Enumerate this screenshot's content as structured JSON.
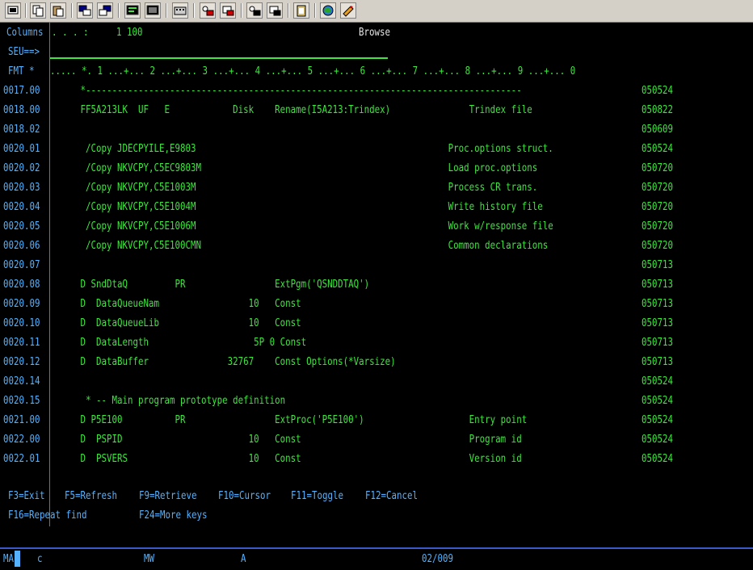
{
  "toolbar": {
    "buttons": [
      {
        "name": "print-screen-icon"
      },
      {
        "name": "copy-icon"
      },
      {
        "name": "paste-icon"
      },
      {
        "name": "send-icon"
      },
      {
        "name": "receive-icon"
      },
      {
        "name": "display-icon"
      },
      {
        "name": "keypad-icon"
      },
      {
        "name": "macro-icon"
      },
      {
        "name": "record-macro-icon"
      },
      {
        "name": "stop-record-icon"
      },
      {
        "name": "play-macro-icon"
      },
      {
        "name": "play-macro2-icon"
      },
      {
        "name": "clipboard-icon"
      },
      {
        "name": "globe-icon"
      },
      {
        "name": "help-icon"
      }
    ]
  },
  "header": {
    "columns_label": "Columns",
    "columns_dots": ". . . :",
    "columns_value": "1 100",
    "mode_title": "Browse",
    "seu_prompt": "SEU==>",
    "seu_input": ""
  },
  "ruler": {
    "fmt_label": "FMT *",
    "scale": "..... *. 1 ...+... 2 ...+... 3 ...+... 4 ...+... 5 ...+... 6 ...+... 7 ...+... 8 ...+... 9 ...+... 0"
  },
  "source_lines": [
    {
      "seq": "0017.00",
      "text": "     *-----------------------------------------------------------------------------------",
      "date": "050524"
    },
    {
      "seq": "0018.00",
      "text": "     FF5A213LK  UF   E            Disk    Rename(I5A213:Trindex)               Trindex file",
      "date": "050822"
    },
    {
      "seq": "0018.02",
      "text": "",
      "date": "050609"
    },
    {
      "seq": "0020.01",
      "text": "      /Copy JDECPYILE,E9803                                                Proc.options struct.",
      "date": "050524"
    },
    {
      "seq": "0020.02",
      "text": "      /Copy NKVCPY,C5EC9803M                                               Load proc.options",
      "date": "050720"
    },
    {
      "seq": "0020.03",
      "text": "      /Copy NKVCPY,C5E1003M                                                Process CR trans.",
      "date": "050720"
    },
    {
      "seq": "0020.04",
      "text": "      /Copy NKVCPY,C5E1004M                                                Write history file",
      "date": "050720"
    },
    {
      "seq": "0020.05",
      "text": "      /Copy NKVCPY,C5E1006M                                                Work w/response file",
      "date": "050720"
    },
    {
      "seq": "0020.06",
      "text": "      /Copy NKVCPY,C5E100CMN                                               Common declarations",
      "date": "050720"
    },
    {
      "seq": "0020.07",
      "text": "",
      "date": "050713"
    },
    {
      "seq": "0020.08",
      "text": "     D SndDtaQ         PR                 ExtPgm('QSNDDTAQ')",
      "date": "050713"
    },
    {
      "seq": "0020.09",
      "text": "     D  DataQueueNam                 10   Const",
      "date": "050713"
    },
    {
      "seq": "0020.10",
      "text": "     D  DataQueueLib                 10   Const",
      "date": "050713"
    },
    {
      "seq": "0020.11",
      "text": "     D  DataLength                    5P 0 Const",
      "date": "050713"
    },
    {
      "seq": "0020.12",
      "text": "     D  DataBuffer               32767    Const Options(*Varsize)",
      "date": "050713"
    },
    {
      "seq": "0020.14",
      "text": "",
      "date": "050524"
    },
    {
      "seq": "0020.15",
      "text": "      * -- Main program prototype definition",
      "date": "050524"
    },
    {
      "seq": "0021.00",
      "text": "     D P5E100          PR                 ExtProc('P5E100')                    Entry point",
      "date": "050524"
    },
    {
      "seq": "0022.00",
      "text": "     D  PSPID                        10   Const                                Program id",
      "date": "050524"
    },
    {
      "seq": "0022.01",
      "text": "     D  PSVERS                       10   Const                                Version id",
      "date": "050524"
    }
  ],
  "function_keys": {
    "row1": [
      "F3=Exit",
      "F5=Refresh",
      "F9=Retrieve",
      "F10=Cursor",
      "F11=Toggle",
      "F12=Cancel"
    ],
    "row2": [
      "F16=Repeat find",
      "F24=More keys"
    ]
  },
  "status_bar": {
    "session": "MA",
    "indicator_c": "c",
    "mw": "MW",
    "a": "A",
    "cursor_pos": "02/009"
  },
  "colors": {
    "background": "#000000",
    "text_green": "#3ee63e",
    "text_cyan": "#54b2ff",
    "status_border": "#3a5acc"
  }
}
